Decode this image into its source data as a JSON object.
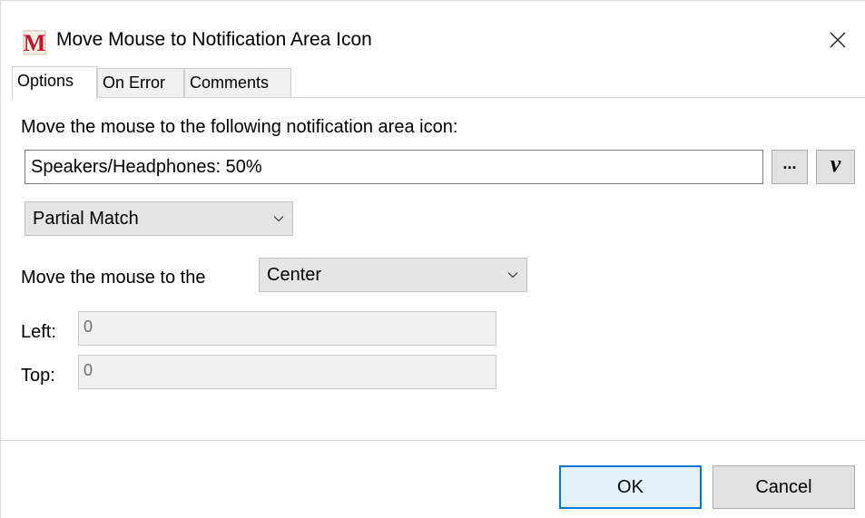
{
  "window": {
    "title": "Move Mouse to Notification Area Icon",
    "app_icon_letter": "M",
    "app_icon_color": "#c8102e",
    "close_icon": "close-icon"
  },
  "tabs": [
    {
      "label": "Options",
      "active": true
    },
    {
      "label": "On Error",
      "active": false
    },
    {
      "label": "Comments",
      "active": false
    }
  ],
  "options": {
    "instruction_label": "Move the mouse to the following notification area icon:",
    "icon_name_value": "Speakers/Headphones: 50%",
    "browse_button_label": "...",
    "variable_button_label": "v",
    "match_mode": {
      "selected": "Partial Match"
    },
    "move_to_label": "Move the mouse to the",
    "move_to_position": {
      "selected": "Center"
    },
    "left_label": "Left:",
    "left_value": "0",
    "top_label": "Top:",
    "top_value": "0"
  },
  "footer": {
    "ok_label": "OK",
    "cancel_label": "Cancel"
  },
  "colors": {
    "accent": "#0078d7",
    "button_bg": "#e1e1e1",
    "disabled_bg": "#f0f0f0"
  }
}
